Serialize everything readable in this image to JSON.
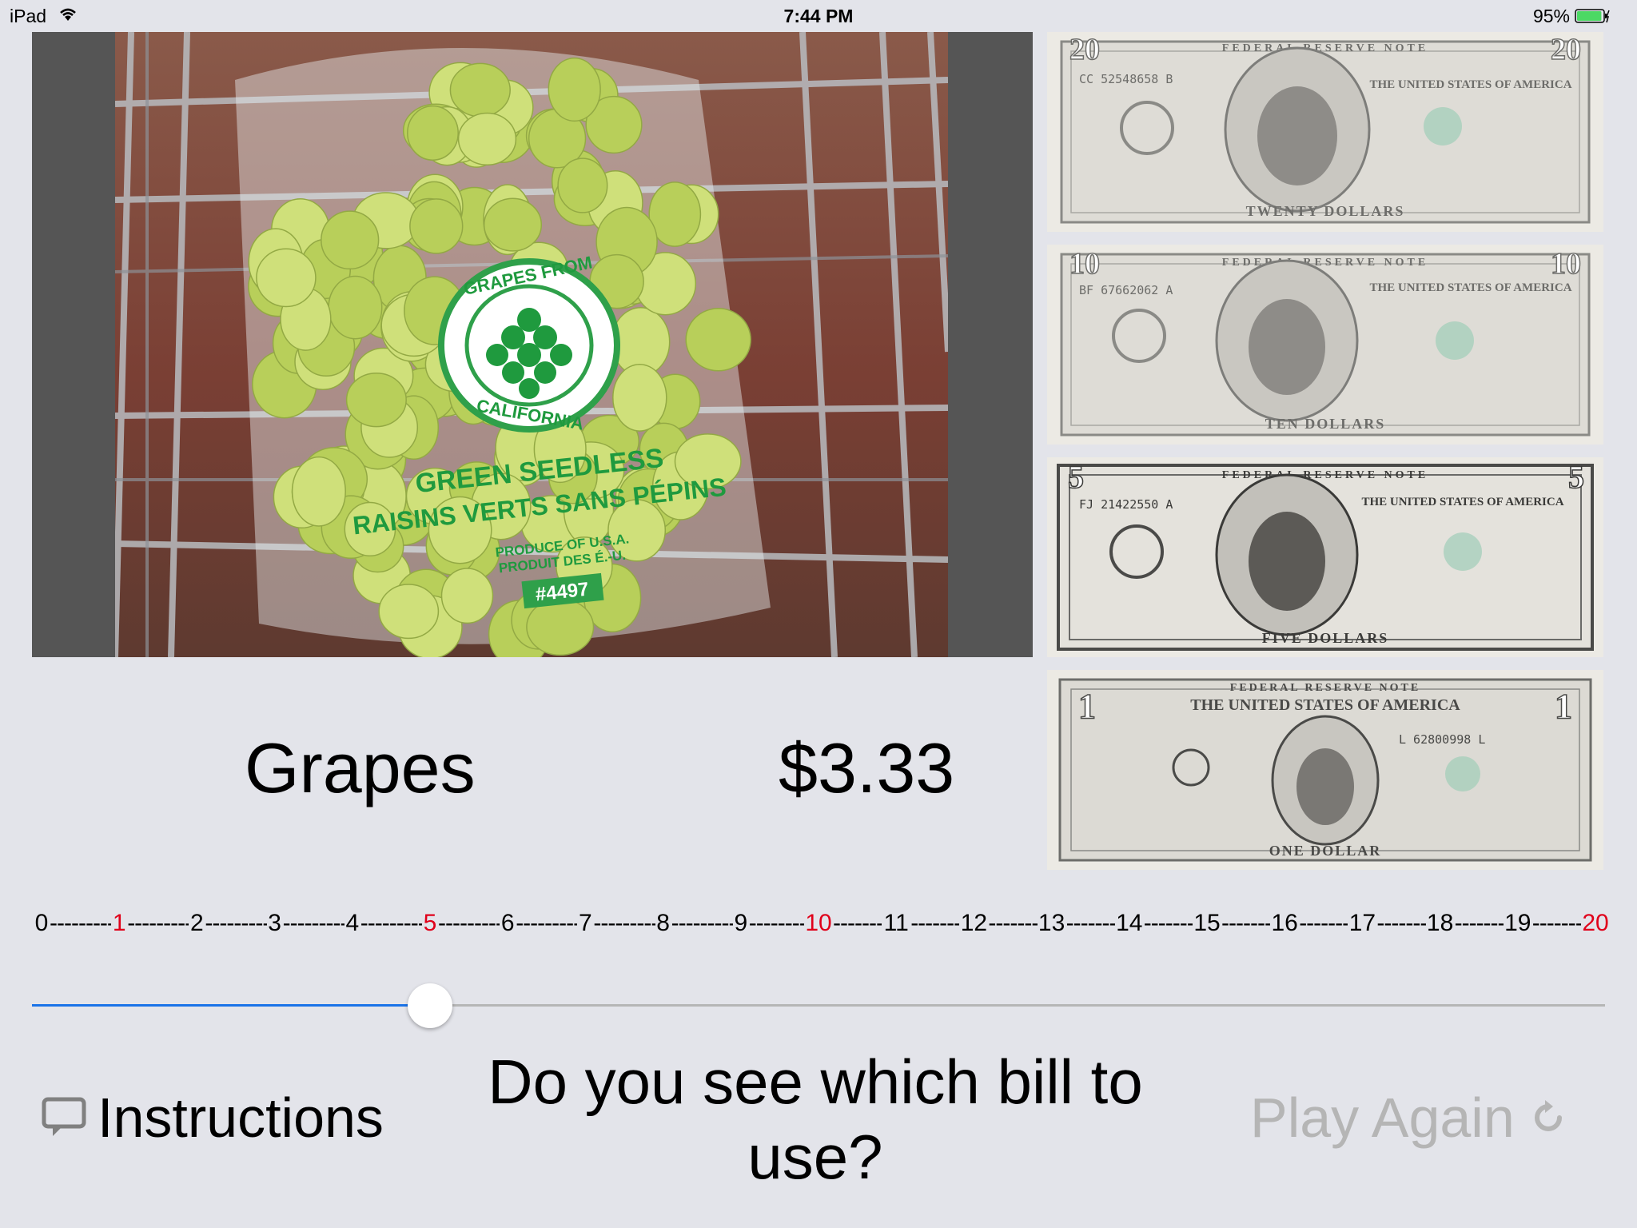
{
  "status_bar": {
    "device": "iPad",
    "time": "7:44 PM",
    "battery_percent": "95%",
    "battery_level": 0.95,
    "wifi_icon": "wifi-icon",
    "battery_icon": "battery-charging-icon"
  },
  "photo": {
    "alt": "bag of green seedless grapes in a shopping cart",
    "label_top": "GRAPES FROM",
    "label_bottom": "CALIFORNIA",
    "label_line1": "GREEN SEEDLESS",
    "label_line2": "RAISINS VERTS SANS PÉPINS",
    "label_line3": "PRODUCE OF U.S.A.",
    "label_line4": "PRODUIT DES É.-U.",
    "plu": "#4497"
  },
  "bills": [
    {
      "denomination": "20",
      "header": "FEDERAL RESERVE NOTE",
      "nation": "THE UNITED STATES OF AMERICA",
      "serial": "CC 52548658 B",
      "bottom_text": "TWENTY DOLLARS"
    },
    {
      "denomination": "10",
      "header": "FEDERAL RESERVE NOTE",
      "nation": "THE UNITED STATES OF AMERICA",
      "serial": "BF 67662062 A",
      "bottom_text": "TEN DOLLARS"
    },
    {
      "denomination": "5",
      "header": "FEDERAL RESERVE NOTE",
      "nation": "THE UNITED STATES OF AMERICA",
      "serial": "FJ 21422550 A",
      "bottom_text": "FIVE DOLLARS"
    },
    {
      "denomination": "1",
      "header": "FEDERAL RESERVE NOTE",
      "nation": "THE UNITED STATES OF AMERICA",
      "serial": "L 62800998 L",
      "bottom_text": "ONE DOLLAR"
    }
  ],
  "item": {
    "name": "Grapes",
    "price": "$3.33"
  },
  "number_line": {
    "labels": [
      "0",
      "1",
      "2",
      "3",
      "4",
      "5",
      "6",
      "7",
      "8",
      "9",
      "10",
      "11",
      "12",
      "13",
      "14",
      "15",
      "16",
      "17",
      "18",
      "19",
      "20"
    ],
    "highlighted": [
      "1",
      "5",
      "10",
      "20"
    ],
    "highlight_color": "#e0001a"
  },
  "slider": {
    "min": 0,
    "max": 20,
    "value": 5,
    "fill_color": "#1a73e8",
    "track_color": "#b6b6b6"
  },
  "controls": {
    "instructions_label": "Instructions",
    "instructions_icon": "speech-bubble-icon",
    "prompt": "Do you see which bill to use?",
    "play_again_label": "Play Again",
    "play_again_icon": "replay-icon"
  }
}
